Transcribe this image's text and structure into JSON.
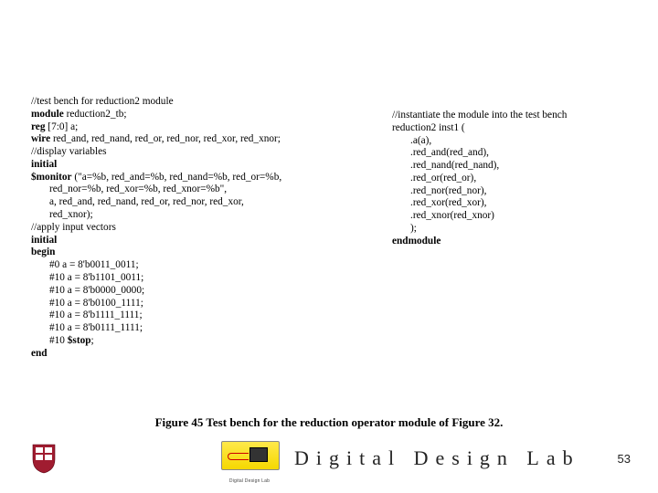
{
  "code_left": {
    "l1a": "//test bench for reduction2 module",
    "l2a": "module",
    "l2b": " reduction2_tb;",
    "l3a": "reg",
    "l3b": " [7:0] a;",
    "l4a": "wire",
    "l4b": " red_and, red_nand, red_or, red_nor, red_xor, red_xnor;",
    "l5": "//display variables",
    "l6": "initial",
    "l7a": "$monitor",
    "l7b": " (\"a=%b, red_and=%b, red_nand=%b, red_or=%b,",
    "l8": "red_nor=%b, red_xor=%b, red_xnor=%b\",",
    "l9": "a, red_and, red_nand, red_or, red_nor, red_xor,",
    "l10": "red_xnor);",
    "l11": "//apply input vectors",
    "l12": "initial",
    "l13": "begin",
    "l14": "#0 a = 8'b0011_0011;",
    "l15": "#10 a = 8'b1101_0011;",
    "l16": "#10 a = 8'b0000_0000;",
    "l17": "#10 a = 8'b0100_1111;",
    "l18": "#10 a = 8'b1111_1111;",
    "l19": "#10 a = 8'b0111_1111;",
    "l20a": "#10 ",
    "l20b": "$stop",
    "l20c": ";",
    "l21": "end"
  },
  "code_right": {
    "r1": "//instantiate the module into the test bench",
    "r2": "reduction2 inst1 (",
    "r3": ".a(a),",
    "r4": ".red_and(red_and),",
    "r5": ".red_nand(red_nand),",
    "r6": ".red_or(red_or),",
    "r7": ".red_nor(red_nor),",
    "r8": ".red_xor(red_xor),",
    "r9": ".red_xnor(red_xnor)",
    "r10": ");",
    "r11": "endmodule"
  },
  "caption": "Figure 45 Test bench for the reduction operator module of Figure 32.",
  "footer": {
    "brand": "Digital Design Lab",
    "logo_sub": "Digital Design Lab",
    "page": "53"
  }
}
